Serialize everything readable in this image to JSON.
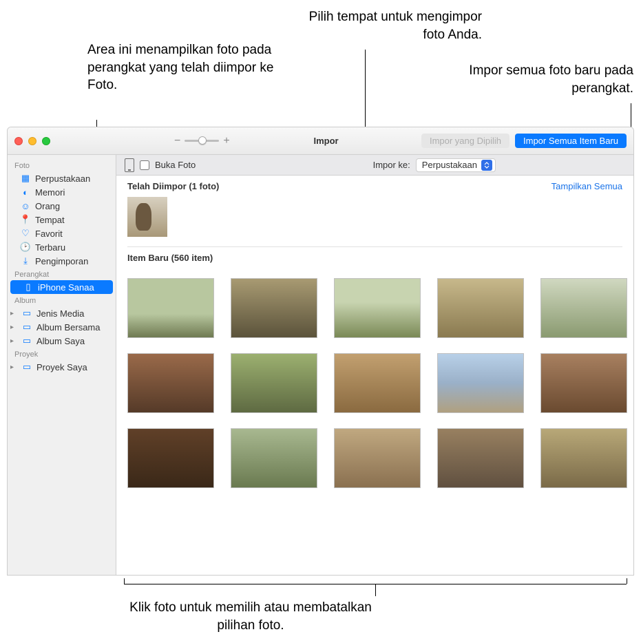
{
  "callouts": {
    "imported_area": "Area ini menampilkan foto pada perangkat yang telah diimpor ke Foto.",
    "import_dest": "Pilih tempat untuk mengimpor foto Anda.",
    "import_all": "Impor semua foto baru pada perangkat.",
    "click_select": "Klik foto untuk memilih atau membatalkan pilihan foto."
  },
  "titlebar": {
    "title": "Impor",
    "zoom_minus": "−",
    "zoom_plus": "+",
    "import_selected": "Impor yang Dipilih",
    "import_all_new": "Impor Semua Item Baru"
  },
  "importbar": {
    "open_photos": "Buka Foto",
    "import_to_label": "Impor ke:",
    "import_to_value": "Perpustakaan"
  },
  "sidebar": {
    "section_foto": "Foto",
    "items_foto": [
      {
        "icon": "▦",
        "label": "Perpustakaan"
      },
      {
        "icon": "◐",
        "label": "Memori"
      },
      {
        "icon": "☺",
        "label": "Orang"
      },
      {
        "icon": "📍",
        "label": "Tempat"
      },
      {
        "icon": "♡",
        "label": "Favorit"
      },
      {
        "icon": "🕑",
        "label": "Terbaru"
      },
      {
        "icon": "⤓",
        "label": "Pengimporan"
      }
    ],
    "section_perangkat": "Perangkat",
    "device": {
      "icon": "▯",
      "label": "iPhone Sanaa"
    },
    "section_album": "Album",
    "items_album": [
      {
        "label": "Jenis Media"
      },
      {
        "label": "Album Bersama"
      },
      {
        "label": "Album Saya"
      }
    ],
    "section_proyek": "Proyek",
    "items_proyek": [
      {
        "label": "Proyek Saya"
      }
    ]
  },
  "content": {
    "already_imported_label": "Telah Diimpor (1 foto)",
    "show_all": "Tampilkan Semua",
    "new_items_label": "Item Baru (560 item)"
  }
}
